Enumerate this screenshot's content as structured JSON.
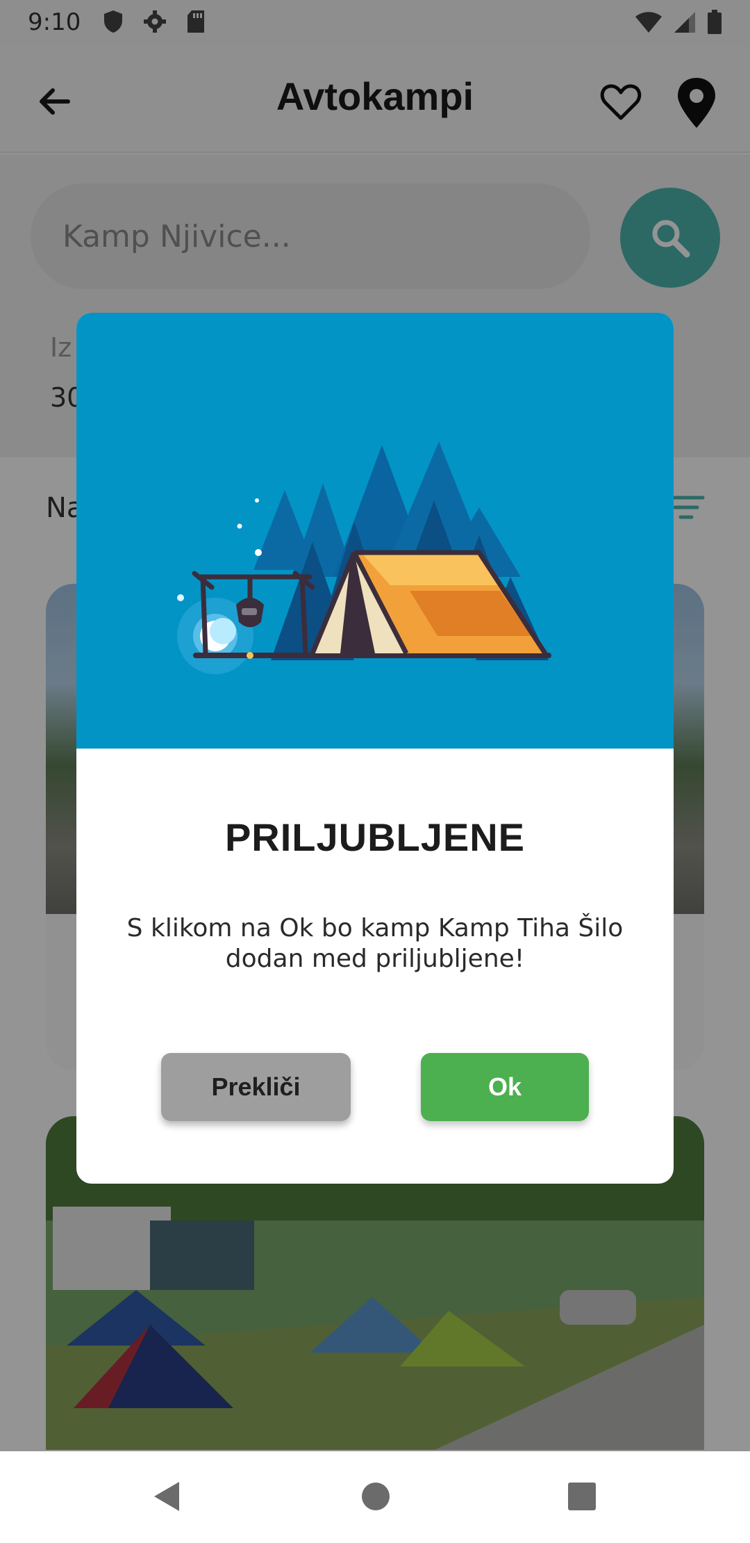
{
  "status_bar": {
    "time": "9:10",
    "left_icons": [
      "shield-icon",
      "gear-icon",
      "sd-card-icon"
    ],
    "right_icons": [
      "wifi-icon",
      "signal-icon",
      "battery-icon"
    ]
  },
  "app_bar": {
    "title": "Avtokampi",
    "icons": [
      "back-arrow-icon",
      "heart-outline-icon",
      "map-pin-icon"
    ]
  },
  "search": {
    "placeholder": "Kamp Njivice...",
    "button_icon": "search-icon"
  },
  "filters": {
    "left_label_partial": "Iz",
    "left_value_partial": "30",
    "right_label_partial": ":"
  },
  "list": {
    "sort_label_partial": "Na",
    "sort_icon": "filter-lines-icon"
  },
  "dialog": {
    "hero_icon": "camping-tent-illustration",
    "title": "PRILJUBLJENE",
    "message": "S klikom na Ok bo kamp Kamp Tiha Šilo dodan med priljubljene!",
    "cancel_label": "Prekliči",
    "ok_label": "Ok"
  },
  "colors": {
    "accent_teal": "#4db6ac",
    "hero_blue": "#0394c6",
    "ok_green": "#4caf50",
    "cancel_gray": "#9e9e9e"
  },
  "nav_bar": {
    "icons": [
      "nav-back-icon",
      "nav-home-icon",
      "nav-recents-icon"
    ]
  }
}
